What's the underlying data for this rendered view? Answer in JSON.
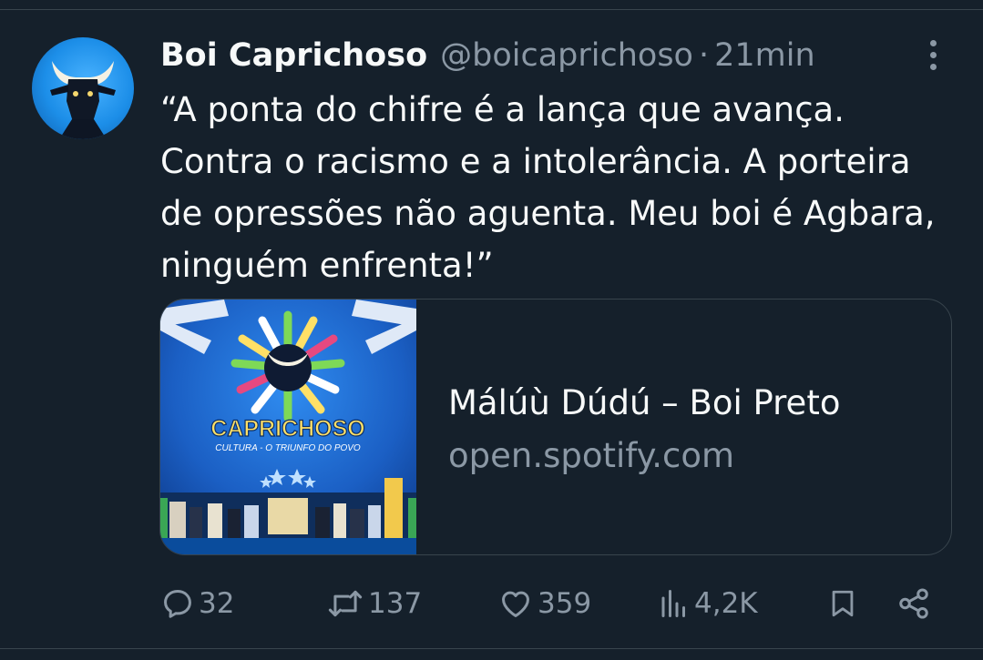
{
  "tweet": {
    "display_name": "Boi Caprichoso",
    "handle": "@boicaprichoso",
    "separator": "·",
    "time": "21min",
    "text": "“A ponta do chifre é a lança que avança.\nContra o racismo e a intolerância. A porteira\nde opressões não aguenta. Meu boi é Agbara,\nninguém enfrenta!”",
    "avatar_icon": "bull-head-icon",
    "more_icon": "more-vertical-icon"
  },
  "card": {
    "title": "Málúù Dúdú – Boi Preto",
    "domain": "open.spotify.com",
    "image": {
      "brand_text": "CAPRICHOSO",
      "tagline": "CULTURA - O TRIUNFO DO POVO"
    }
  },
  "actions": {
    "reply": {
      "icon": "reply-icon",
      "count": "32"
    },
    "retweet": {
      "icon": "retweet-icon",
      "count": "137"
    },
    "like": {
      "icon": "heart-icon",
      "count": "359"
    },
    "views": {
      "icon": "views-chart-icon",
      "count": "4,2K"
    },
    "bookmark": {
      "icon": "bookmark-icon"
    },
    "share": {
      "icon": "share-icon"
    }
  },
  "colors": {
    "background": "#15202b",
    "text_primary": "#f7f9f9",
    "text_secondary": "#8b98a5",
    "border": "#38444d",
    "brand_blue": "#1d8ce8"
  }
}
